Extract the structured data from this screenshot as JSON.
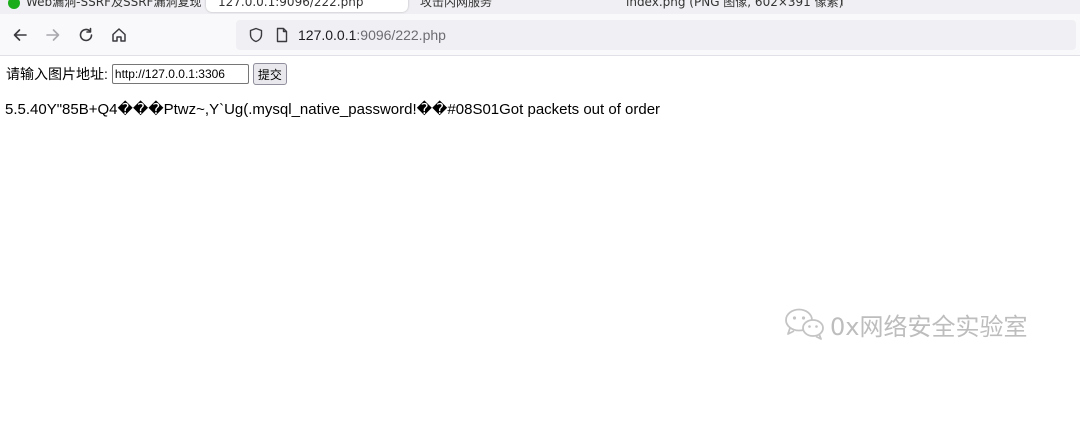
{
  "browser": {
    "tabs": [
      {
        "title": "Web漏洞-SSRF及SSRF漏洞复现"
      },
      {
        "title": "127.0.0.1:9096/222.php"
      },
      {
        "title": "攻击内网服务"
      },
      {
        "title": "index.png (PNG 图像, 602×391 像素)"
      }
    ],
    "url": {
      "host": "127.0.0.1",
      "path": ":9096/222.php"
    }
  },
  "page": {
    "form": {
      "label": "请输入图片地址:",
      "input_value": "http://127.0.0.1:3306",
      "submit_label": "提交"
    },
    "response_text": "5.5.40Y\"85B+Q4���Ptwz~,Y`Ug(.mysql_native_password!��#08S01Got packets out of order"
  },
  "watermark": {
    "text": "0x网络安全实验室",
    "icon": "wechat-icon"
  }
}
